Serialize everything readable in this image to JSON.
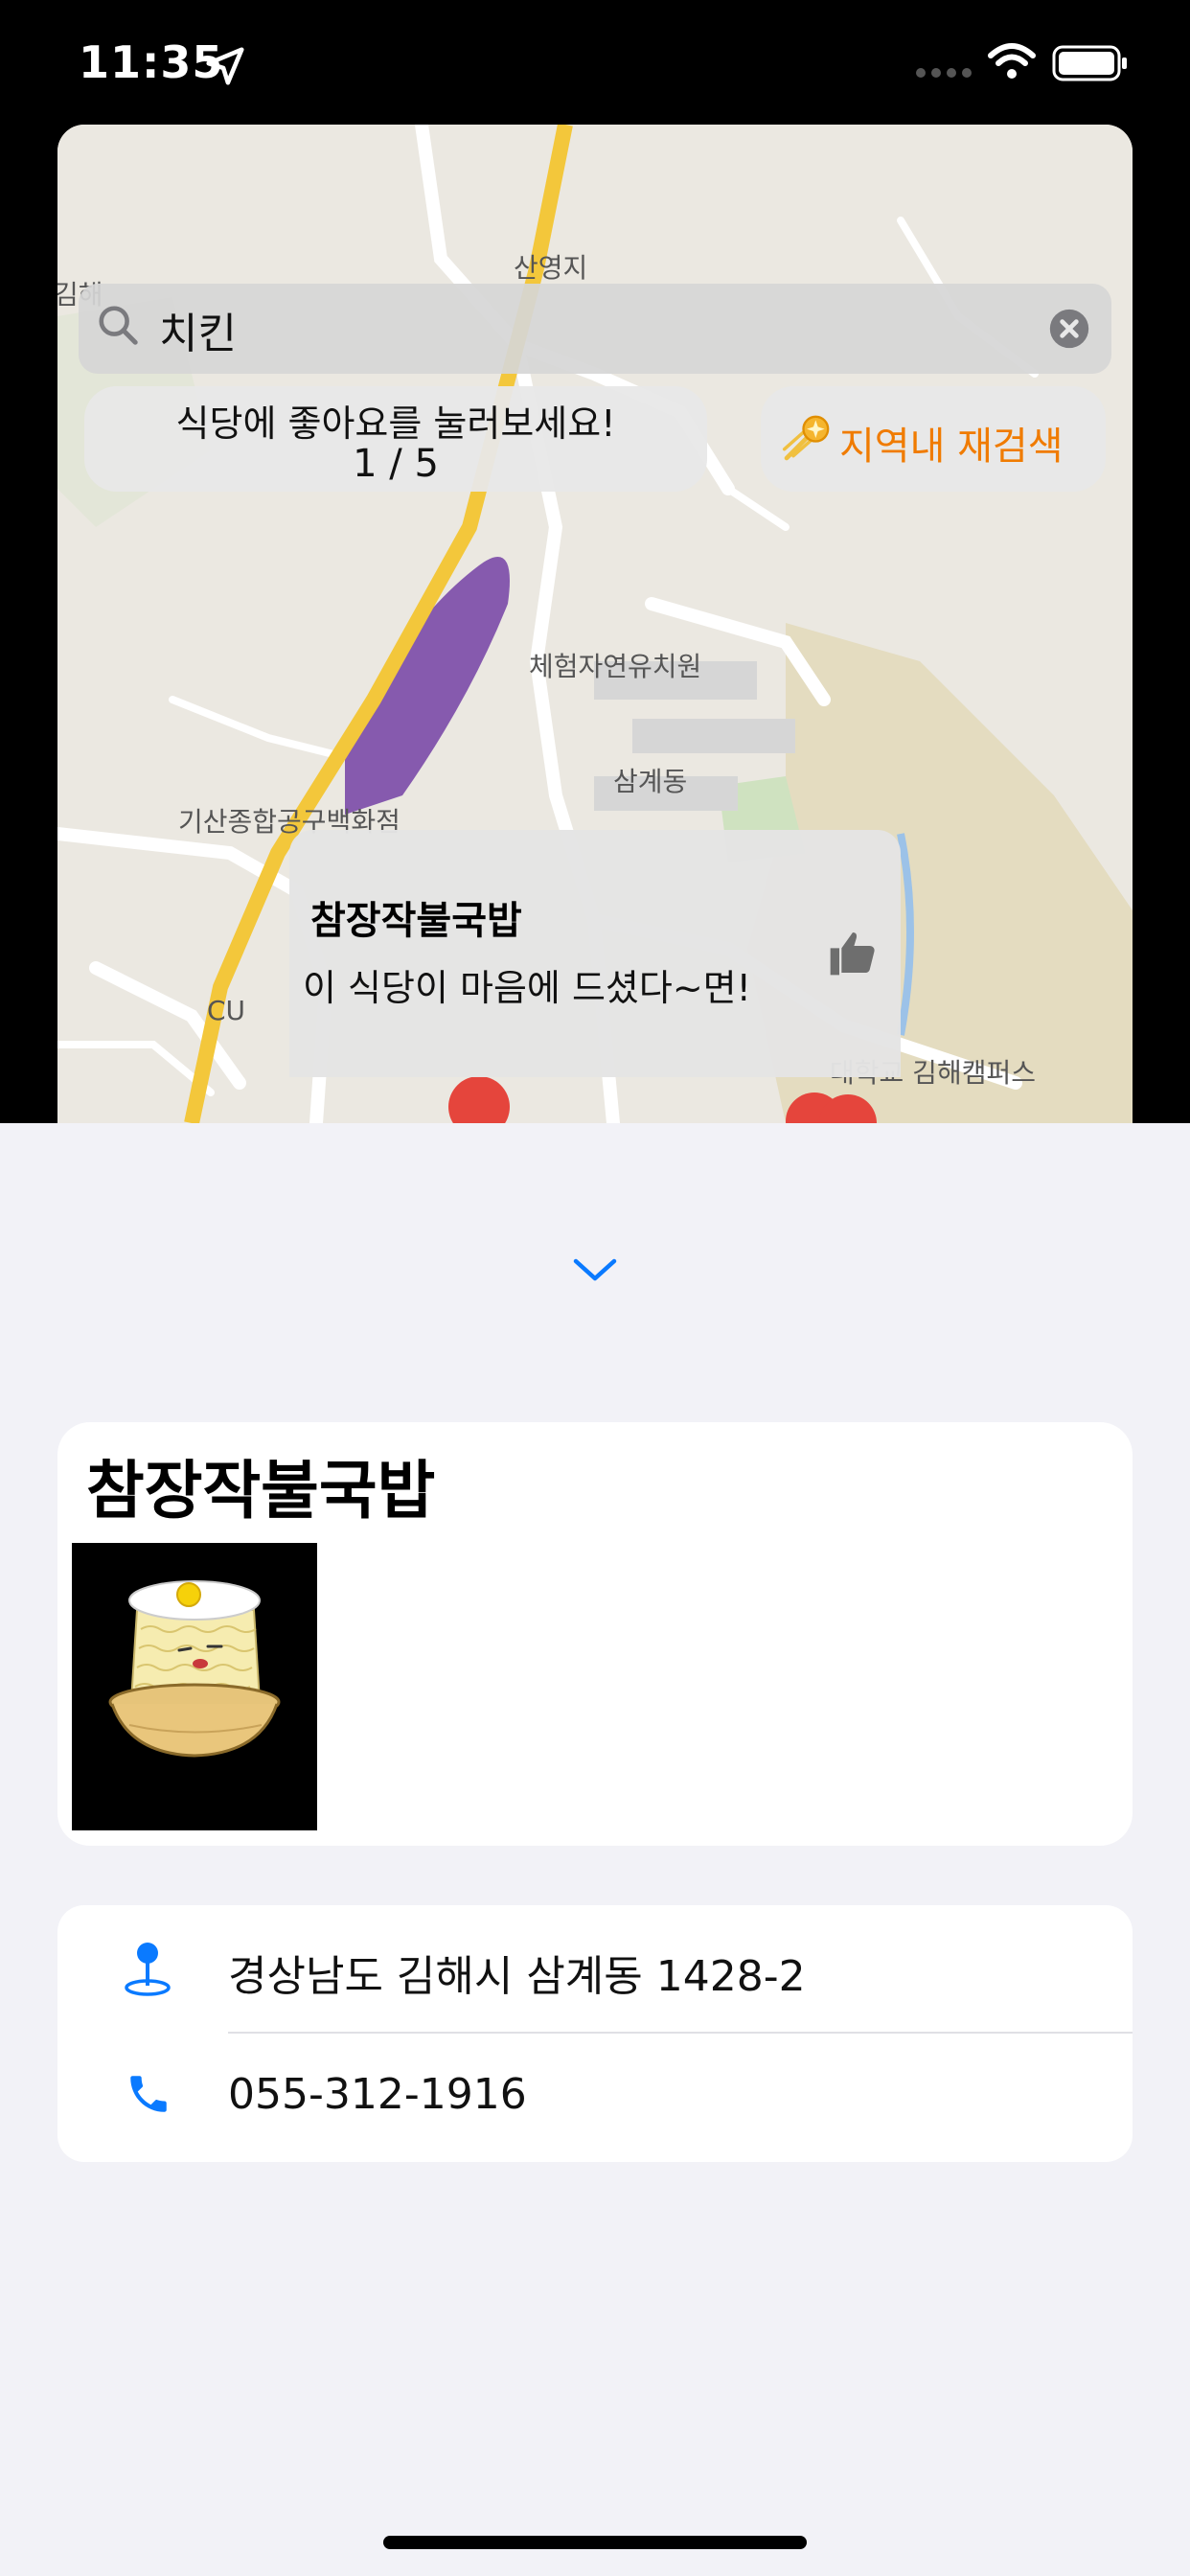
{
  "status_bar": {
    "time": "11:35"
  },
  "map": {
    "labels": {
      "sanyeongji": "산영지",
      "experience_forest": "체험자연유치원",
      "samgye_dong": "삼계동",
      "gisan_store": "기산종합공구백화점",
      "cu": "CU",
      "campus": "대학교 김해캠퍼스",
      "gimhae_edge": "김해"
    },
    "search": {
      "query": "치킨"
    },
    "hint": {
      "line1": "식당에 좋아요를 눌러보세요!",
      "counter": "1 / 5"
    },
    "research_button": {
      "label": "지역내 재검색",
      "icon": "comet-icon"
    },
    "callout": {
      "title": "참장작불국밥",
      "subtitle": "이 식당이 마음에 드셨다~면!",
      "icon": "thumbs-up-icon"
    }
  },
  "detail": {
    "name": "참장작불국밥",
    "address": "경상남도 김해시 삼계동 1428-2",
    "phone": "055-312-1916"
  },
  "colors": {
    "accent_blue": "#0a7aff",
    "research_orange": "#f07b00",
    "map_road_yellow": "#f3c73b",
    "rail_purple": "#7b4aa8",
    "marker_red": "#e5453c"
  }
}
